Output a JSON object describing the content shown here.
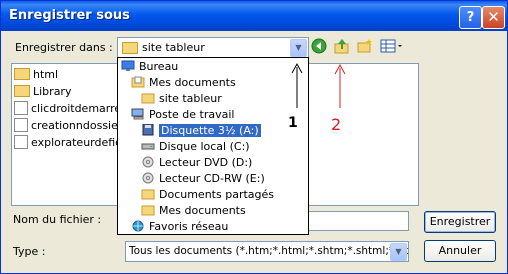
{
  "window": {
    "title": "Enregistrer sous",
    "help_label": "?",
    "close_label": "✕"
  },
  "save_in": {
    "label": "Enregistrer dans :",
    "value": "site tableur"
  },
  "toolbar": {
    "back_icon": "back-icon",
    "up_icon": "up-folder-icon",
    "newfolder_icon": "new-folder-icon",
    "views_icon": "views-icon"
  },
  "files": [
    {
      "name": "html",
      "type": "folder"
    },
    {
      "name": "Library",
      "type": "folder"
    },
    {
      "name": "clicdroitdemarrer.",
      "type": "file"
    },
    {
      "name": "creationndossier.",
      "type": "file"
    },
    {
      "name": "explorateurdefich",
      "type": "file"
    }
  ],
  "dropdown": [
    {
      "label": "Bureau",
      "icon": "desktop-icon",
      "indent": 0,
      "selected": false
    },
    {
      "label": "Mes documents",
      "icon": "documents-icon",
      "indent": 1,
      "selected": false
    },
    {
      "label": "site tableur",
      "icon": "folder-icon",
      "indent": 2,
      "selected": false
    },
    {
      "label": "Poste de travail",
      "icon": "computer-icon",
      "indent": 1,
      "selected": false
    },
    {
      "label": "Disquette 3½ (A:)",
      "icon": "floppy-icon",
      "indent": 2,
      "selected": true
    },
    {
      "label": "Disque local (C:)",
      "icon": "harddisk-icon",
      "indent": 2,
      "selected": false
    },
    {
      "label": "Lecteur DVD (D:)",
      "icon": "dvd-icon",
      "indent": 2,
      "selected": false
    },
    {
      "label": "Lecteur CD-RW (E:)",
      "icon": "cd-icon",
      "indent": 2,
      "selected": false
    },
    {
      "label": "Documents partagés",
      "icon": "folder-icon",
      "indent": 2,
      "selected": false
    },
    {
      "label": "Mes documents",
      "icon": "folder-icon",
      "indent": 2,
      "selected": false
    },
    {
      "label": "Favoris réseau",
      "icon": "network-icon",
      "indent": 1,
      "selected": false
    }
  ],
  "filename": {
    "label": "Nom du fichier :",
    "value": ""
  },
  "filetype": {
    "label": "Type :",
    "value": "Tous les documents (*.htm;*.html;*.shtm;*.shtml;*.hta;*.h"
  },
  "buttons": {
    "save": "Enregistrer",
    "cancel": "Annuler"
  },
  "annotations": {
    "marker1": "1",
    "marker2": "2",
    "color_red": "#d42020",
    "color_black": "#000000"
  }
}
